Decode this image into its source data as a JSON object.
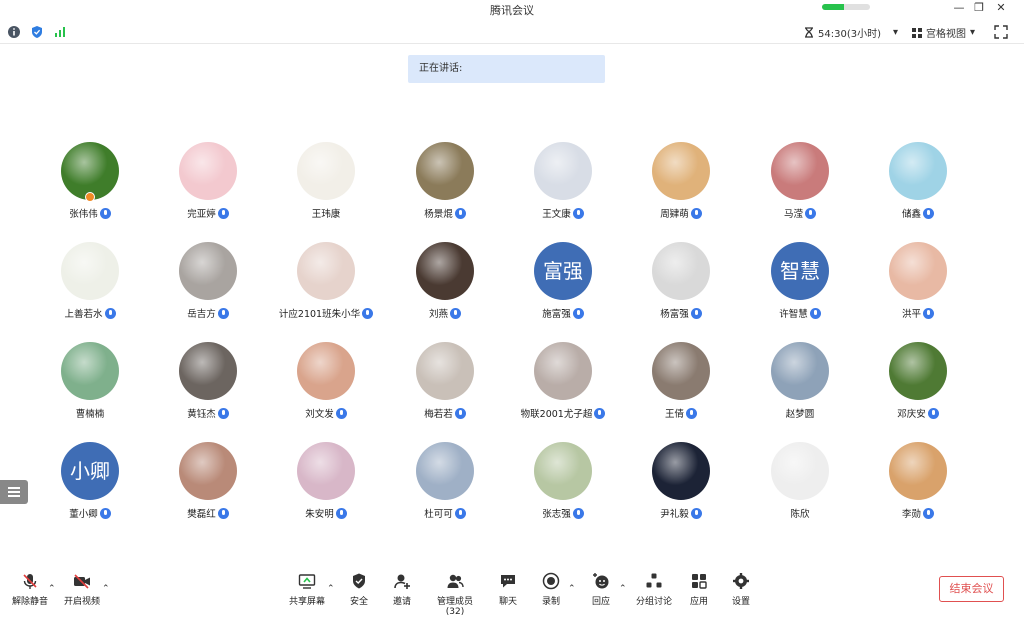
{
  "window": {
    "title": "腾讯会议",
    "network_quality": 0.45
  },
  "status": {
    "timer": "54:30(3小时)",
    "view_mode": "宫格视图"
  },
  "speaking_label": "正在讲话:",
  "participants": [
    {
      "name": "张伟伟",
      "host": true,
      "mic": true,
      "avatar": "photo",
      "color": "#3f7d2a"
    },
    {
      "name": "完亚婷",
      "host": false,
      "mic": true,
      "avatar": "photo",
      "color": "#f3c9cf"
    },
    {
      "name": "王玮康",
      "host": false,
      "mic": false,
      "avatar": "photo",
      "color": "#f2efe8"
    },
    {
      "name": "杨景焜",
      "host": false,
      "mic": true,
      "avatar": "photo",
      "color": "#8b7b5a"
    },
    {
      "name": "王文康",
      "host": false,
      "mic": true,
      "avatar": "photo",
      "color": "#d8dde6"
    },
    {
      "name": "周肄萌",
      "host": false,
      "mic": true,
      "avatar": "photo",
      "color": "#e0b27a"
    },
    {
      "name": "马滢",
      "host": false,
      "mic": true,
      "avatar": "photo",
      "color": "#c97b7b"
    },
    {
      "name": "储鑫",
      "host": false,
      "mic": true,
      "avatar": "photo",
      "color": "#9fd3e6"
    },
    {
      "name": "上善若水",
      "host": false,
      "mic": true,
      "avatar": "photo",
      "color": "#eef0e8"
    },
    {
      "name": "岳吉方",
      "host": false,
      "mic": true,
      "avatar": "photo",
      "color": "#a9a4a0"
    },
    {
      "name": "计应2101班朱小华",
      "host": false,
      "mic": true,
      "avatar": "photo",
      "color": "#e6d3cc"
    },
    {
      "name": "刘燕",
      "host": false,
      "mic": true,
      "avatar": "photo",
      "color": "#4a3a32"
    },
    {
      "name": "施富强",
      "host": false,
      "mic": true,
      "avatar": "text",
      "avatar_text": "富强"
    },
    {
      "name": "杨富强",
      "host": false,
      "mic": true,
      "avatar": "photo",
      "color": "#d9d9d9"
    },
    {
      "name": "许智慧",
      "host": false,
      "mic": true,
      "avatar": "text",
      "avatar_text": "智慧"
    },
    {
      "name": "洪平",
      "host": false,
      "mic": true,
      "avatar": "photo",
      "color": "#e8b9a4"
    },
    {
      "name": "曹楠楠",
      "host": false,
      "mic": false,
      "avatar": "photo",
      "color": "#7fb08c"
    },
    {
      "name": "黄钰杰",
      "host": false,
      "mic": true,
      "avatar": "photo",
      "color": "#6c6560"
    },
    {
      "name": "刘文发",
      "host": false,
      "mic": true,
      "avatar": "photo",
      "color": "#d9a48c"
    },
    {
      "name": "梅若若",
      "host": false,
      "mic": true,
      "avatar": "photo",
      "color": "#c9c0b8"
    },
    {
      "name": "物联2001尤子超",
      "host": false,
      "mic": true,
      "avatar": "photo",
      "color": "#b9ada8"
    },
    {
      "name": "王倩",
      "host": false,
      "mic": true,
      "avatar": "photo",
      "color": "#8a7b70"
    },
    {
      "name": "赵梦圆",
      "host": false,
      "mic": false,
      "avatar": "photo",
      "color": "#8ea2b8"
    },
    {
      "name": "邓庆安",
      "host": false,
      "mic": true,
      "avatar": "photo",
      "color": "#4f7a34"
    },
    {
      "name": "董小卿",
      "host": false,
      "mic": true,
      "avatar": "text",
      "avatar_text": "小卿"
    },
    {
      "name": "樊磊红",
      "host": false,
      "mic": true,
      "avatar": "photo",
      "color": "#b98a78"
    },
    {
      "name": "朱安明",
      "host": false,
      "mic": true,
      "avatar": "photo",
      "color": "#d8b7c8"
    },
    {
      "name": "杜可可",
      "host": false,
      "mic": true,
      "avatar": "photo",
      "color": "#9fb0c6"
    },
    {
      "name": "张志强",
      "host": false,
      "mic": true,
      "avatar": "photo",
      "color": "#b7c7a3"
    },
    {
      "name": "尹礼毅",
      "host": false,
      "mic": true,
      "avatar": "photo",
      "color": "#1c2336"
    },
    {
      "name": "陈欣",
      "host": false,
      "mic": false,
      "avatar": "photo",
      "color": "#eeeeee"
    },
    {
      "name": "李勋",
      "host": false,
      "mic": true,
      "avatar": "photo",
      "color": "#d9a26b"
    }
  ],
  "toolbar": {
    "unmute": "解除静音",
    "start_video": "开启视频",
    "share_screen": "共享屏幕",
    "security": "安全",
    "invite": "邀请",
    "manage_members": "管理成员(32)",
    "chat": "聊天",
    "record": "录制",
    "reaction": "回应",
    "breakout": "分组讨论",
    "apps": "应用",
    "settings": "设置",
    "end_meeting": "结束会议"
  },
  "colors": {
    "accent": "#3a78e8",
    "end": "#e05050",
    "speaking_bg": "#dbe8fb"
  }
}
